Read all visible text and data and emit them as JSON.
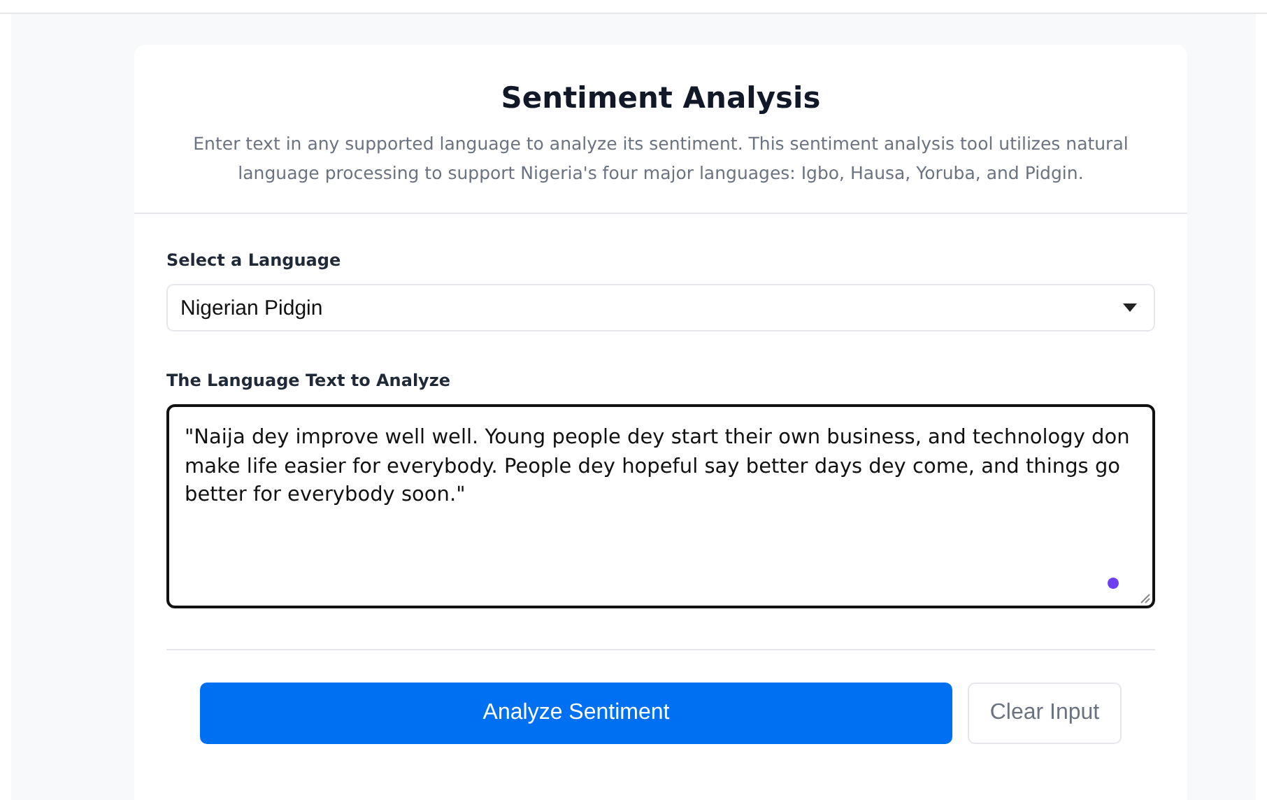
{
  "header": {
    "title": "Sentiment Analysis",
    "description": "Enter text in any supported language to analyze its sentiment. This sentiment analysis tool utilizes natural language processing to support Nigeria's four major languages: Igbo, Hausa, Yoruba, and Pidgin."
  },
  "language_field": {
    "label": "Select a Language",
    "value": "Nigerian Pidgin"
  },
  "text_field": {
    "label": "The Language Text to Analyze",
    "value": "\"Naija dey improve well well. Young people dey start their own business, and technology don make life easier for everybody. People dey hopeful say better days dey come, and things go better for everybody soon.\""
  },
  "buttons": [
    {
      "kind": "primary",
      "label": "Analyze Sentiment"
    },
    {
      "kind": "secondary",
      "label": "Clear Input"
    }
  ]
}
